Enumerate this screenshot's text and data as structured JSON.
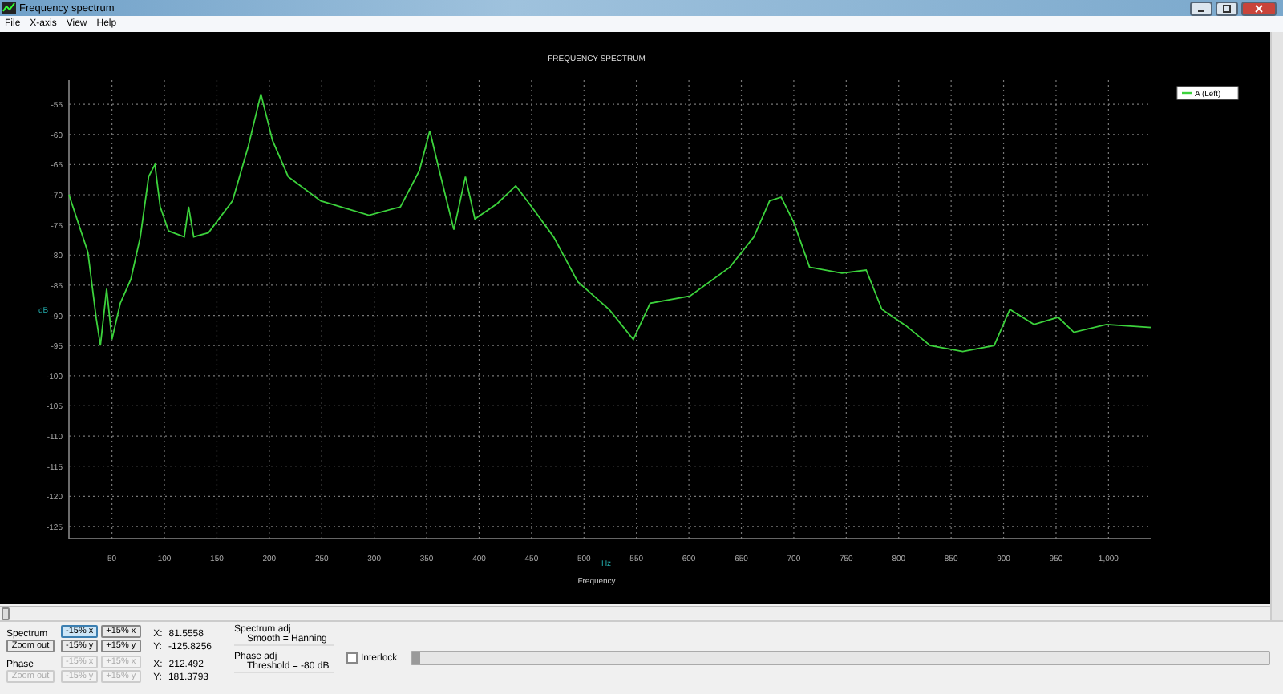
{
  "window": {
    "title": "Frequency spectrum"
  },
  "menu": [
    "File",
    "X-axis",
    "View",
    "Help"
  ],
  "chart": {
    "chart_data": {
      "type": "line",
      "title": "FREQUENCY SPECTRUM",
      "xlabel": "Frequency",
      "ylabel": "dB",
      "x": [
        9,
        27,
        35,
        39,
        45,
        50,
        58,
        68,
        77,
        85,
        91,
        96,
        104,
        119,
        123,
        128,
        142,
        165,
        180,
        192,
        203,
        218,
        249,
        295,
        325,
        343,
        353,
        362,
        376,
        387,
        396,
        417,
        435,
        448,
        471,
        494,
        524,
        547,
        563,
        601,
        639,
        662,
        677,
        688,
        700,
        715,
        746,
        769,
        784,
        807,
        830,
        861,
        891,
        906,
        929,
        952,
        967,
        998,
        1041
      ],
      "series": [
        {
          "name": "A (Left)",
          "color": "#3cd23c",
          "values": [
            -70,
            -79.5,
            -90.5,
            -95,
            -85.6,
            -94,
            -88,
            -84,
            -77,
            -67,
            -65,
            -72,
            -76,
            -77,
            -72,
            -77,
            -76.3,
            -71,
            -62,
            -53.3,
            -61,
            -67,
            -71,
            -73.4,
            -72,
            -66,
            -59.4,
            -66,
            -75.8,
            -67,
            -74,
            -71.5,
            -68.5,
            -71.5,
            -77,
            -84.4,
            -89,
            -94,
            -88,
            -86.8,
            -82,
            -77,
            -71,
            -70.4,
            -74.6,
            -82,
            -83,
            -82.5,
            -89,
            -91.7,
            -95,
            -96,
            -95,
            -89,
            -91.5,
            -90.3,
            -92.8,
            -91.5,
            -92
          ]
        }
      ],
      "xlim": [
        9,
        1041
      ],
      "ylim": [
        -127,
        -51
      ],
      "grid": true,
      "xticks": [
        50,
        100,
        150,
        200,
        250,
        300,
        350,
        400,
        450,
        500,
        550,
        600,
        650,
        700,
        750,
        800,
        850,
        900,
        950,
        {
          "value": 1000,
          "label": "1,000"
        }
      ],
      "yticks": [
        -55,
        -60,
        -65,
        -70,
        -75,
        -80,
        -85,
        -90,
        -95,
        -100,
        -105,
        -110,
        -115,
        -120,
        -125
      ]
    },
    "xunit": "Hz"
  },
  "spectrum": {
    "label": "Spectrum",
    "zoom_out": {
      "label": "Zoom out",
      "disabled": false
    },
    "buttons": [
      {
        "label": "-15% x",
        "selected": true,
        "disabled": false
      },
      {
        "label": "+15% x",
        "selected": false,
        "disabled": false
      },
      {
        "label": "-15% y",
        "selected": false,
        "disabled": false
      },
      {
        "label": "+15% y",
        "selected": false,
        "disabled": false
      }
    ],
    "x_label": "X:",
    "x_value": "81.5558",
    "y_label": "Y:",
    "y_value": "-125.8256"
  },
  "phase": {
    "label": "Phase",
    "zoom_out": {
      "label": "Zoom out",
      "disabled": true
    },
    "buttons": [
      {
        "label": "-15% x",
        "selected": false,
        "disabled": true
      },
      {
        "label": "+15% x",
        "selected": false,
        "disabled": true
      },
      {
        "label": "-15% y",
        "selected": false,
        "disabled": true
      },
      {
        "label": "+15% y",
        "selected": false,
        "disabled": true
      }
    ],
    "x_label": "X:",
    "x_value": "212.492",
    "y_label": "Y:",
    "y_value": "181.3793"
  },
  "spectrum_adj": {
    "label": "Spectrum adj",
    "value": "Smooth = Hanning"
  },
  "phase_adj": {
    "label": "Phase adj",
    "value": "Threshold = -80 dB"
  },
  "interlock": {
    "label": "Interlock",
    "checked": false
  },
  "progress": {
    "level": 0.01
  }
}
